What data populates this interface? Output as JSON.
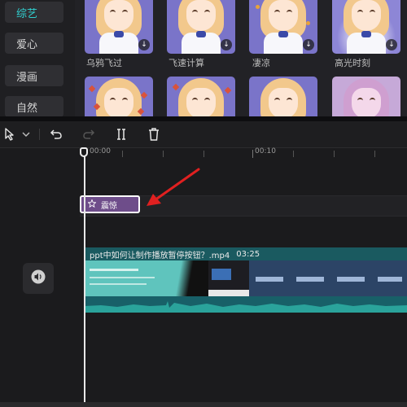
{
  "categories": [
    {
      "label": "综艺",
      "active": true
    },
    {
      "label": "爱心",
      "active": false
    },
    {
      "label": "漫画",
      "active": false
    },
    {
      "label": "自然",
      "active": false
    }
  ],
  "effects": [
    {
      "label": "乌鸦飞过"
    },
    {
      "label": "飞速计算"
    },
    {
      "label": "凄凉"
    },
    {
      "label": "高光时刻"
    }
  ],
  "toolbar": {
    "icons": [
      "select-cursor-icon",
      "chevron-down-icon",
      "undo-icon",
      "redo-icon",
      "split-icon",
      "delete-icon"
    ]
  },
  "ruler": {
    "start": "00:00",
    "mark": "00:10"
  },
  "timeline": {
    "effect_clip": {
      "label": "震惊",
      "icon": "star-icon"
    },
    "video_clip": {
      "filename": "ppt中如何让制作播放暂停按钮？.mp4",
      "duration": "03:25"
    }
  },
  "colors": {
    "accent": "#30d0d0",
    "effect_clip": "#6e4d8a",
    "video_track": "#1c5058",
    "annotation_arrow": "#e02020"
  }
}
